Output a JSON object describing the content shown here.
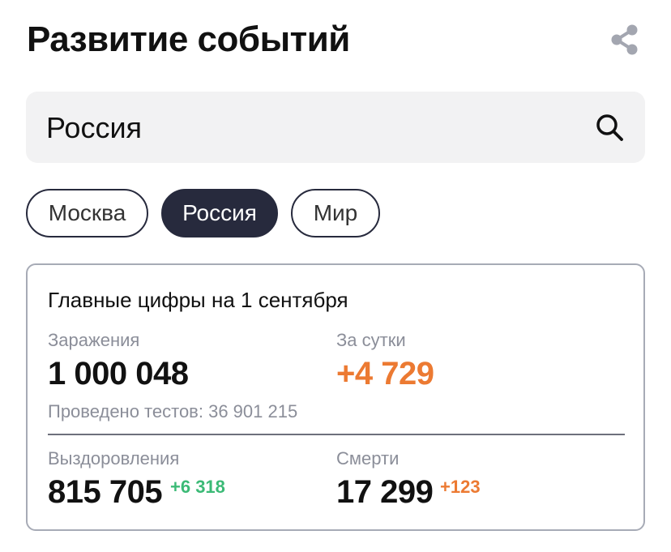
{
  "header": {
    "title": "Развитие событий"
  },
  "search": {
    "value": "Россия"
  },
  "tabs": [
    {
      "label": "Москва",
      "active": false
    },
    {
      "label": "Россия",
      "active": true
    },
    {
      "label": "Мир",
      "active": false
    }
  ],
  "stats": {
    "heading": "Главные цифры на 1 сентября",
    "infections_label": "Заражения",
    "infections_value": "1 000 048",
    "daily_label": "За сутки",
    "daily_value": "+4 729",
    "tests_text": "Проведено тестов: 36 901 215",
    "recoveries_label": "Выздоровления",
    "recoveries_value": "815 705",
    "recoveries_delta": "+6 318",
    "deaths_label": "Смерти",
    "deaths_value": "17 299",
    "deaths_delta": "+123"
  },
  "colors": {
    "accent_orange": "#ec7a32",
    "accent_green": "#3bba76",
    "tab_active": "#272a3d"
  },
  "icons": {
    "share": "share-icon",
    "search": "search-icon"
  }
}
